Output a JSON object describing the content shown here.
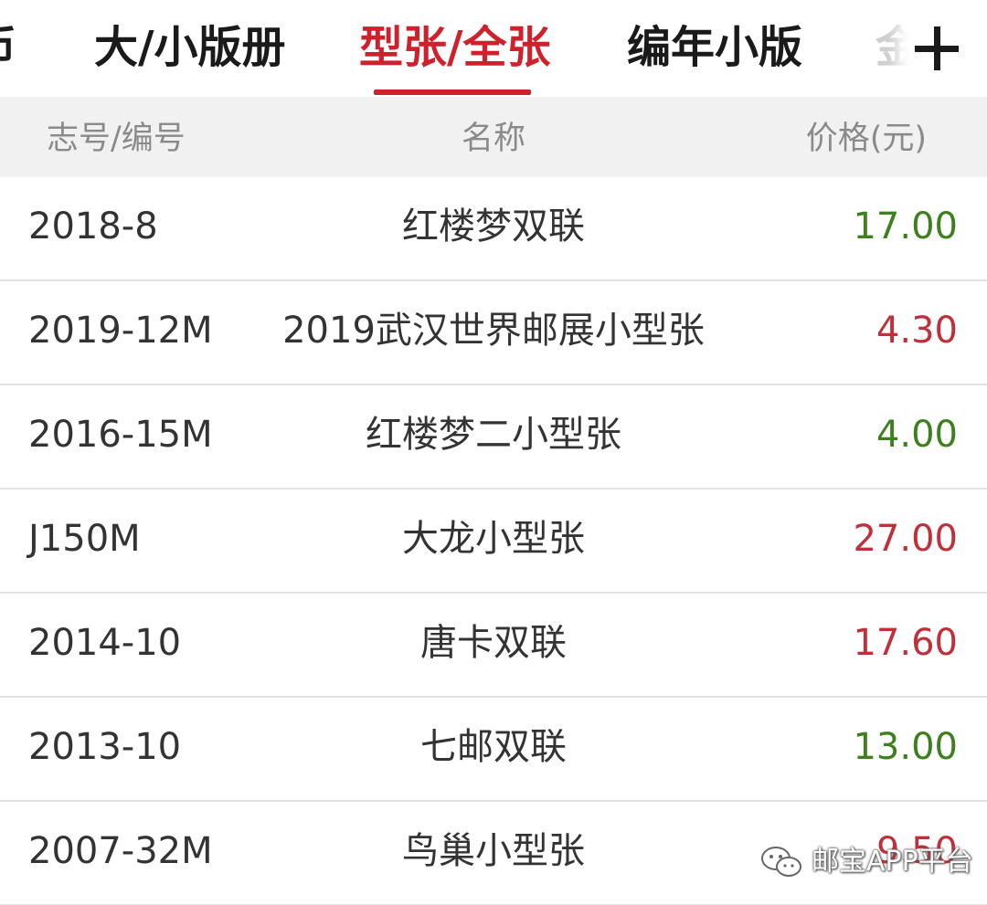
{
  "tabs": [
    {
      "label": "币",
      "state": "partial"
    },
    {
      "label": "大/小版册",
      "state": "normal"
    },
    {
      "label": "型张/全张",
      "state": "active"
    },
    {
      "label": "编年小版",
      "state": "normal"
    },
    {
      "label": "金",
      "state": "partial"
    }
  ],
  "add_icon": "plus-icon",
  "table": {
    "headers": {
      "code": "志号/编号",
      "name": "名称",
      "price": "价格(元)"
    },
    "rows": [
      {
        "code": "2018-8",
        "name": "红楼梦双联",
        "price": "17.00",
        "trend": "down"
      },
      {
        "code": "2019-12M",
        "name": "2019武汉世界邮展小型张",
        "price": "4.30",
        "trend": "up"
      },
      {
        "code": "2016-15M",
        "name": "红楼梦二小型张",
        "price": "4.00",
        "trend": "down"
      },
      {
        "code": "J150M",
        "name": "大龙小型张",
        "price": "27.00",
        "trend": "up"
      },
      {
        "code": "2014-10",
        "name": "唐卡双联",
        "price": "17.60",
        "trend": "up"
      },
      {
        "code": "2013-10",
        "name": "七邮双联",
        "price": "13.00",
        "trend": "down"
      },
      {
        "code": "2007-32M",
        "name": "鸟巢小型张",
        "price": "9.50",
        "trend": "up"
      }
    ]
  },
  "watermark": {
    "icon": "wechat-icon",
    "text": "邮宝APP平台"
  },
  "colors": {
    "accent": "#d0202c",
    "price_up": "#c0303a",
    "price_down": "#3e7f1e",
    "header_bg": "#f1f1f1"
  }
}
